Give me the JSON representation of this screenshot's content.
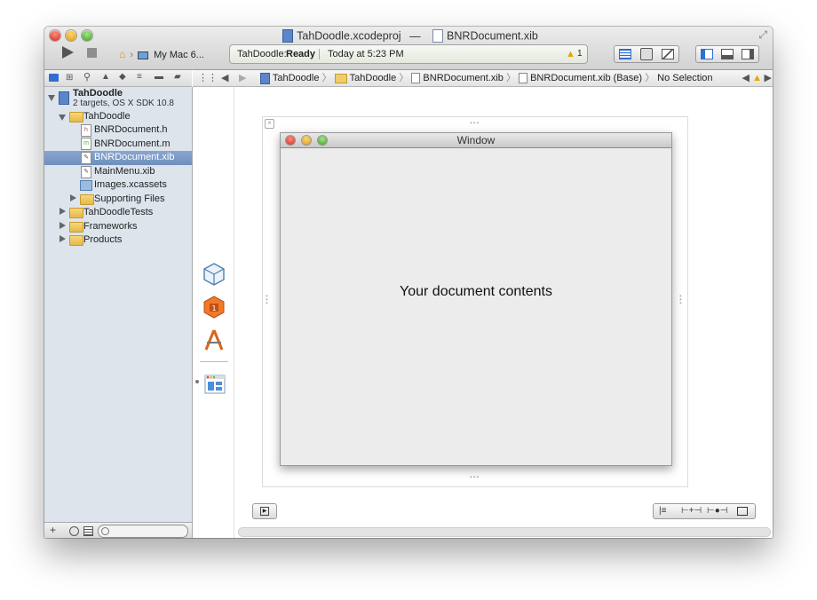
{
  "window": {
    "project_file": "TahDoodle.xcodeproj",
    "separator": "—",
    "open_file": "BNRDocument.xib",
    "resize_glyph": "⤢"
  },
  "toolbar": {
    "scheme_target": "My Mac 6...",
    "status_project": "TahDoodle:",
    "status_state": "Ready",
    "status_time": "Today at 5:23 PM",
    "warning_count": "1",
    "colors": {
      "accent": "#3b7bd8",
      "warning": "#f5c100"
    }
  },
  "jumpbar": {
    "crumbs": [
      "TahDoodle",
      "TahDoodle",
      "BNRDocument.xib",
      "BNRDocument.xib (Base)",
      "No Selection"
    ]
  },
  "navigator": {
    "project_name": "TahDoodle",
    "project_subtitle": "2 targets, OS X SDK 10.8",
    "items": [
      {
        "label": "TahDoodle"
      },
      {
        "label": "BNRDocument.h"
      },
      {
        "label": "BNRDocument.m"
      },
      {
        "label": "BNRDocument.xib"
      },
      {
        "label": "MainMenu.xib"
      },
      {
        "label": "Images.xcassets"
      },
      {
        "label": "Supporting Files"
      },
      {
        "label": "TahDoodleTests"
      },
      {
        "label": "Frameworks"
      },
      {
        "label": "Products"
      }
    ],
    "filter_icons": {
      "add": "+",
      "history": "history-icon",
      "scm": "scm-icon"
    }
  },
  "canvas": {
    "window_title": "Window",
    "content_text": "Your document contents"
  }
}
